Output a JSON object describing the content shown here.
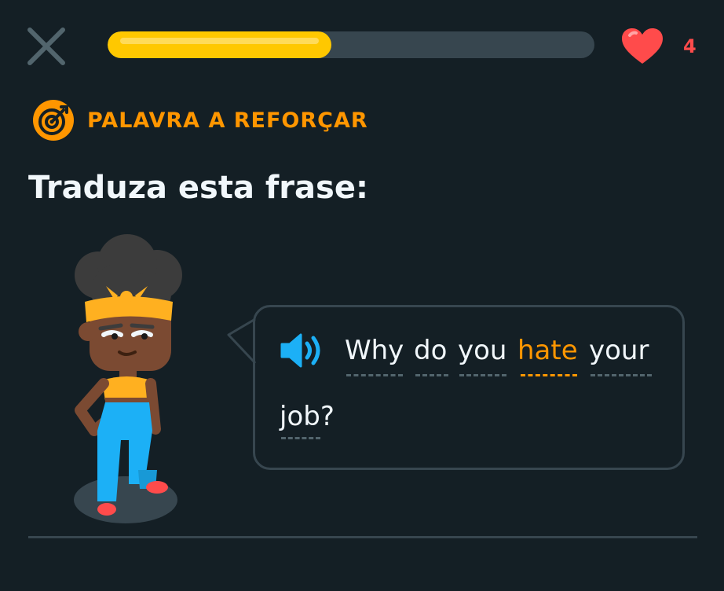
{
  "header": {
    "close_icon": "close-x-icon",
    "progress": {
      "fraction": 0.46,
      "track_color": "#37464f",
      "fill_color": "#ffc800"
    },
    "hearts": {
      "icon": "heart-icon",
      "count": "4",
      "color": "#ff4b4b"
    }
  },
  "badge": {
    "icon": "target-icon",
    "label": "PALAVRA A REFORÇAR",
    "color": "#ff9600"
  },
  "title": "Traduza esta frase:",
  "prompt": {
    "speaker_icon": "speaker-icon",
    "words": [
      {
        "text": "Why",
        "highlight": false
      },
      {
        "text": "do",
        "highlight": false
      },
      {
        "text": "you",
        "highlight": false
      },
      {
        "text": "hate",
        "highlight": true
      },
      {
        "text": "your",
        "highlight": false
      },
      {
        "text": "job?",
        "highlight": false
      }
    ]
  },
  "colors": {
    "background": "#141f25",
    "accent": "#ff9600",
    "text": "#f1f7fb"
  }
}
